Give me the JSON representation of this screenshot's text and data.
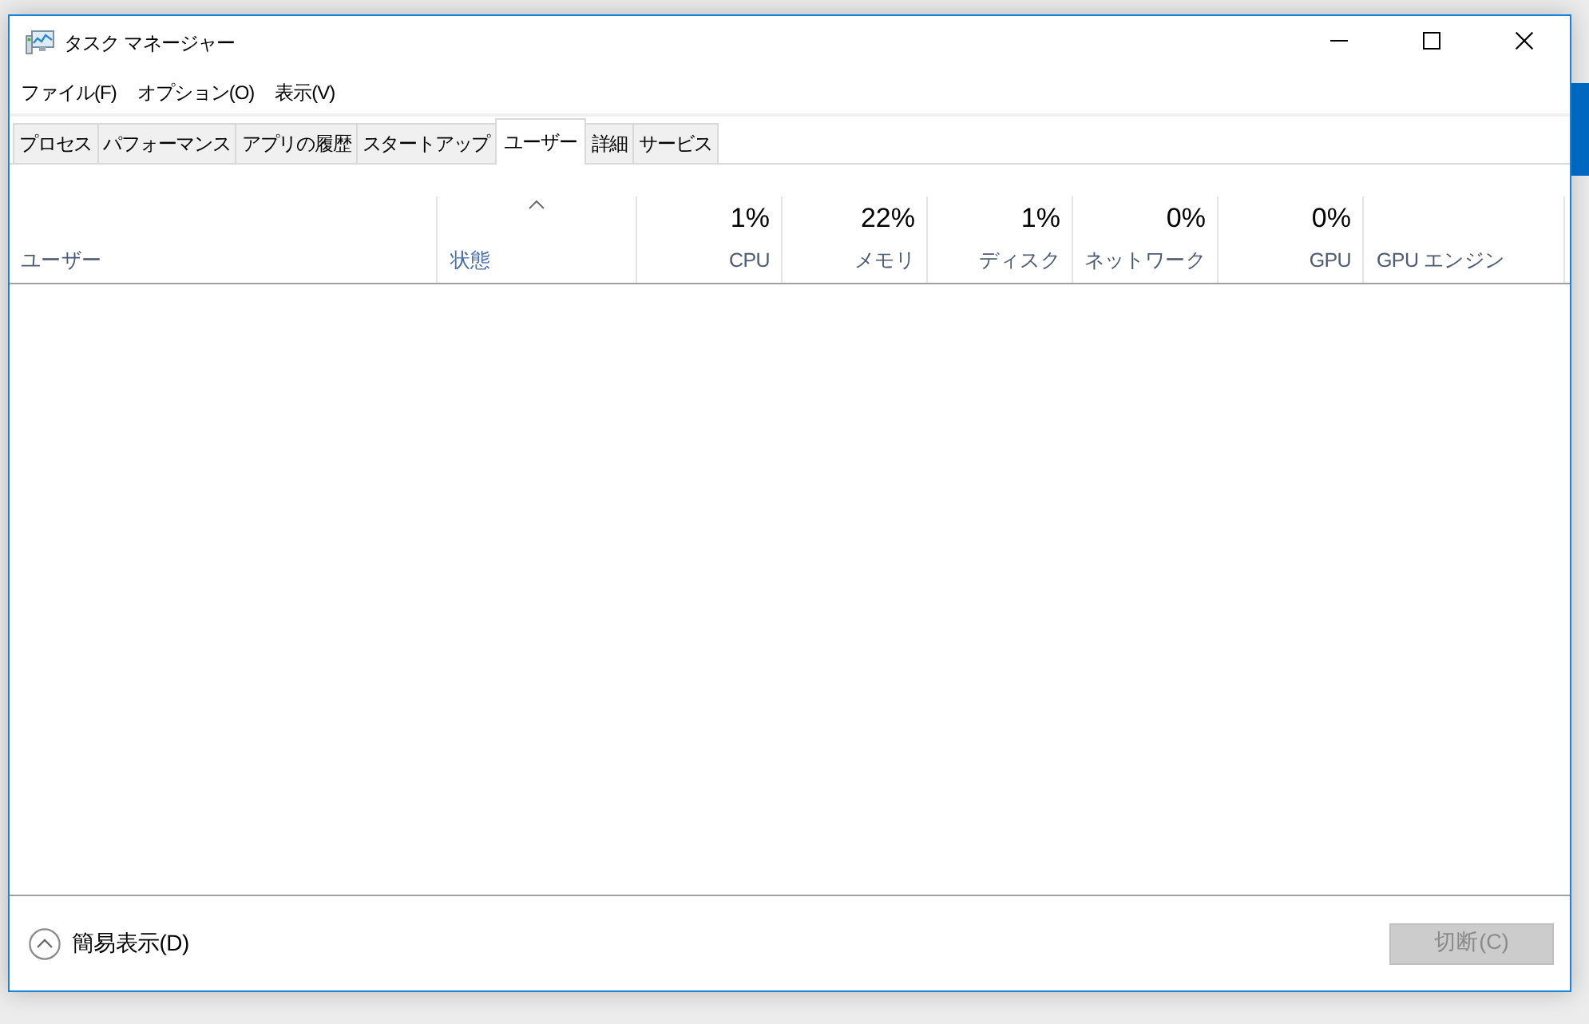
{
  "window": {
    "title": "タスク マネージャー"
  },
  "menu": [
    {
      "label": "ファイル(F)"
    },
    {
      "label": "オプション(O)"
    },
    {
      "label": "表示(V)"
    }
  ],
  "tabs": [
    {
      "label": "プロセス",
      "selected": false
    },
    {
      "label": "パフォーマンス",
      "selected": false
    },
    {
      "label": "アプリの履歴",
      "selected": false
    },
    {
      "label": "スタートアップ",
      "selected": false
    },
    {
      "label": "ユーザー",
      "selected": true
    },
    {
      "label": "詳細",
      "selected": false
    },
    {
      "label": "サービス",
      "selected": false
    }
  ],
  "columns": [
    {
      "kind": "text",
      "label": "ユーザー",
      "sorted": false
    },
    {
      "kind": "text",
      "label": "状態",
      "sorted": true
    },
    {
      "kind": "metric",
      "reading": "1%",
      "label": "CPU",
      "sorted": false
    },
    {
      "kind": "metric",
      "reading": "22%",
      "label": "メモリ",
      "sorted": false
    },
    {
      "kind": "metric",
      "reading": "1%",
      "label": "ディスク",
      "sorted": false
    },
    {
      "kind": "metric",
      "reading": "0%",
      "label": "ネットワーク",
      "sorted": false
    },
    {
      "kind": "metric",
      "reading": "0%",
      "label": "GPU",
      "sorted": false
    },
    {
      "kind": "text",
      "label": "GPU エンジン",
      "sorted": false
    }
  ],
  "footer": {
    "toggle_label": "簡易表示(D)",
    "button": {
      "label": "切断(C)",
      "disabled": true
    }
  }
}
